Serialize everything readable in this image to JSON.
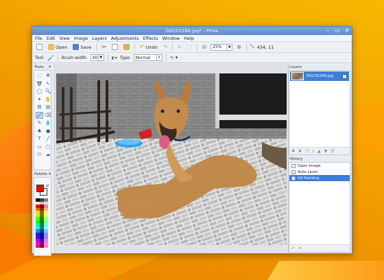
{
  "window": {
    "title": "DSC01299.jpg* - Pinta",
    "controls": [
      "–",
      "▭",
      "✕"
    ]
  },
  "menu": [
    "File",
    "Edit",
    "View",
    "Image",
    "Layers",
    "Adjustments",
    "Effects",
    "Window",
    "Help"
  ],
  "toolbar": {
    "open_label": "Open",
    "save_label": "Save",
    "undo_label": "Undo",
    "zoom_value": "25%",
    "cursor_position": "434, 11"
  },
  "tool_options": {
    "tool_label": "Tool:",
    "brush_width_label": "Brush width:",
    "brush_width_value": "40",
    "type_label": "Type:",
    "type_value": "Normal"
  },
  "tools_pad": {
    "title": "Tools",
    "close": "✕"
  },
  "palette_pad": {
    "title": "Palette",
    "close": "✕"
  },
  "layers_pad": {
    "title": "Layers",
    "items": [
      {
        "label": "DSC01299.jpg",
        "visible": true
      }
    ]
  },
  "history_pad": {
    "title": "History",
    "items": [
      {
        "label": "Open Image",
        "selected": false
      },
      {
        "label": "Auto Level",
        "selected": false
      },
      {
        "label": "Oil Painting",
        "selected": true
      }
    ]
  },
  "colors": {
    "primary": "#ff0000",
    "secondary": "#ffffff",
    "accent": "#3d7fd4"
  }
}
